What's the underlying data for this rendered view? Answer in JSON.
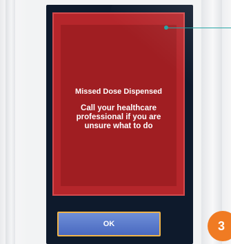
{
  "alert": {
    "title": "Missed Dose Dispensed",
    "message": "Call your healthcare professional if you are unsure what to do"
  },
  "buttons": {
    "ok_label": "OK"
  },
  "step": {
    "number": "3"
  },
  "colors": {
    "alert_red": "#b5262b",
    "screen_dark": "#0e1a2c",
    "ok_blue": "#5b7cd0",
    "ok_border": "#f0b44a",
    "callout_teal": "#27a6a6",
    "badge_orange": "#f07b23"
  },
  "icons": {
    "callout": "callout-pointer"
  }
}
